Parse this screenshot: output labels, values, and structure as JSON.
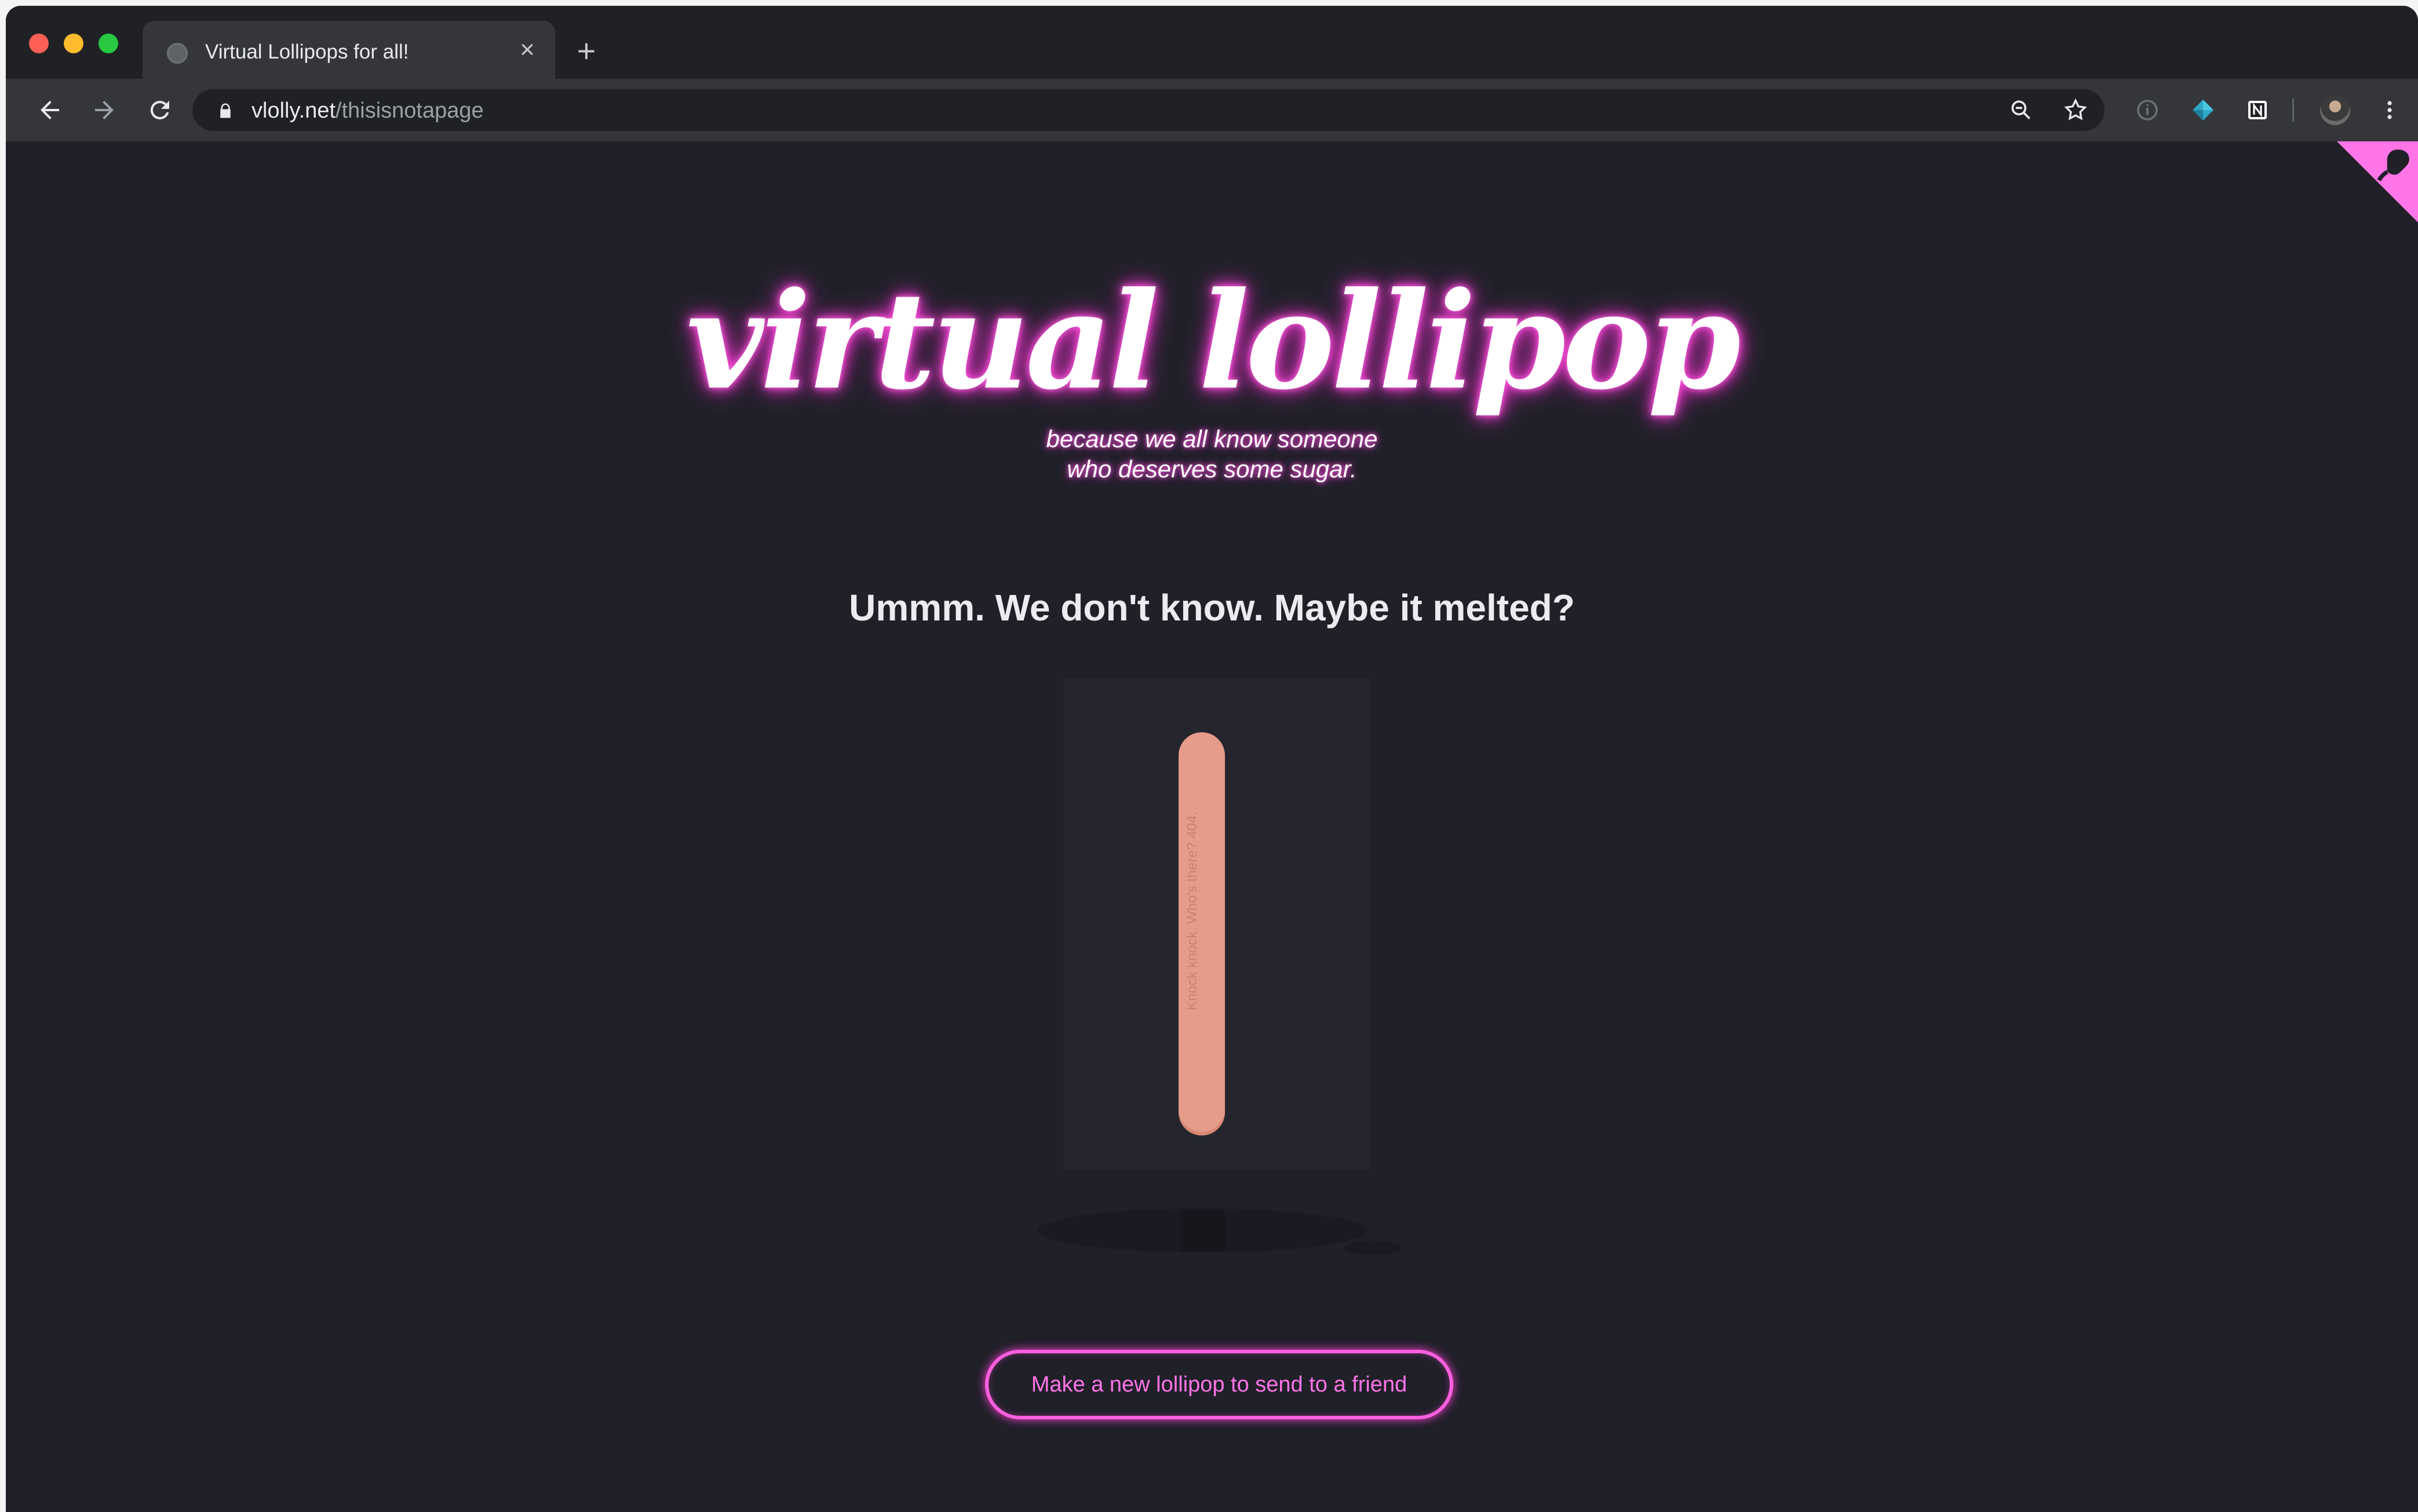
{
  "browser": {
    "tab": {
      "title": "Virtual Lollipops for all!",
      "close_glyph": "×"
    },
    "new_tab_glyph": "+",
    "address": {
      "domain": "vlolly.net",
      "path": "/thisisnotapage"
    },
    "icons": [
      "back-arrow-icon",
      "forward-arrow-icon",
      "reload-icon",
      "lock-icon",
      "zoom-icon",
      "star-icon",
      "info-icon",
      "extension-diamond-icon",
      "notion-icon",
      "avatar",
      "more-menu-icon"
    ],
    "accent_colors": {
      "page_background": "#202029",
      "neon_pink": "#ff5fe0",
      "stick": "#e59c8a"
    }
  },
  "page": {
    "logo": "virtual lollipop",
    "tagline": [
      "because we all know someone",
      "who deserves some sugar."
    ],
    "headline": "Ummm. We don't know. Maybe it melted?",
    "stick_text": "Knock knock. Who's there? 404.",
    "cta_label": "Make a new lollipop to send to a friend",
    "corner_icon": "github-octocat-icon"
  }
}
